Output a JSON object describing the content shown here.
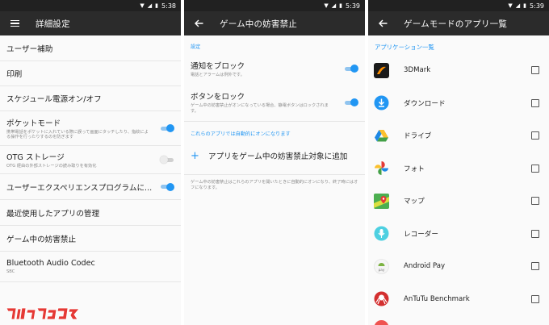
{
  "status": [
    {
      "time": "5:38"
    },
    {
      "time": "5:39"
    },
    {
      "time": "5:39"
    }
  ],
  "screen1": {
    "title": "詳細設定",
    "items": [
      {
        "title": "ユーザー補助",
        "sub": "",
        "toggle": "none"
      },
      {
        "title": "印刷",
        "sub": "",
        "toggle": "none"
      },
      {
        "title": "スケジュール電源オン/オフ",
        "sub": "",
        "toggle": "none"
      },
      {
        "title": "ポケットモード",
        "sub": "携帯電話をポケットに入れている際に誤って画面にタッチしたり、指紋による操作を行ったりするのを防ぎます",
        "toggle": "on"
      },
      {
        "title": "OTG ストレージ",
        "sub": "OTG 経由の外部ストレージの読み取りを有効化",
        "toggle": "off"
      },
      {
        "title": "ユーザーエクスペリエンスプログラムに...",
        "sub": "",
        "toggle": "on"
      },
      {
        "title": "最近使用したアプリの管理",
        "sub": "",
        "toggle": "none"
      },
      {
        "title": "ゲーム中の妨害禁止",
        "sub": "",
        "toggle": "none"
      },
      {
        "title": "Bluetooth Audio Codec",
        "sub": "SBC",
        "toggle": "none"
      }
    ]
  },
  "screen2": {
    "title": "ゲーム中の妨害禁止",
    "section1": "設定",
    "block_notifications": {
      "title": "通知をブロック",
      "sub": "電話とアラームは例外です。"
    },
    "lock_buttons": {
      "title": "ボタンをロック",
      "sub": "ゲーム中の妨害禁止がオンになっている場合、静電ボタンはロックされます。"
    },
    "section2": "これらのアプリでは自動的にオンになります",
    "add_label": "アプリをゲーム中の妨害禁止対象に追加",
    "note": "ゲーム中の妨害禁止はこれらのアプリを開いたときに自動的にオンになり、終了時にはオフになります。"
  },
  "screen3": {
    "title": "ゲームモードのアプリ一覧",
    "section": "アプリケーション一覧",
    "apps": [
      {
        "name": "3DMark",
        "icon": "3dmark-icon"
      },
      {
        "name": "ダウンロード",
        "icon": "download-icon"
      },
      {
        "name": "ドライブ",
        "icon": "drive-icon"
      },
      {
        "name": "フォト",
        "icon": "photos-icon"
      },
      {
        "name": "マップ",
        "icon": "maps-icon"
      },
      {
        "name": "レコーダー",
        "icon": "recorder-icon"
      },
      {
        "name": "Android Pay",
        "icon": "android-pay-icon"
      },
      {
        "name": "AnTuTu Benchmark",
        "icon": "antutu-icon"
      }
    ]
  },
  "colors": {
    "accent": "#2196f3",
    "toolbar": "#2b2b2b",
    "statusbar": "#212121"
  }
}
